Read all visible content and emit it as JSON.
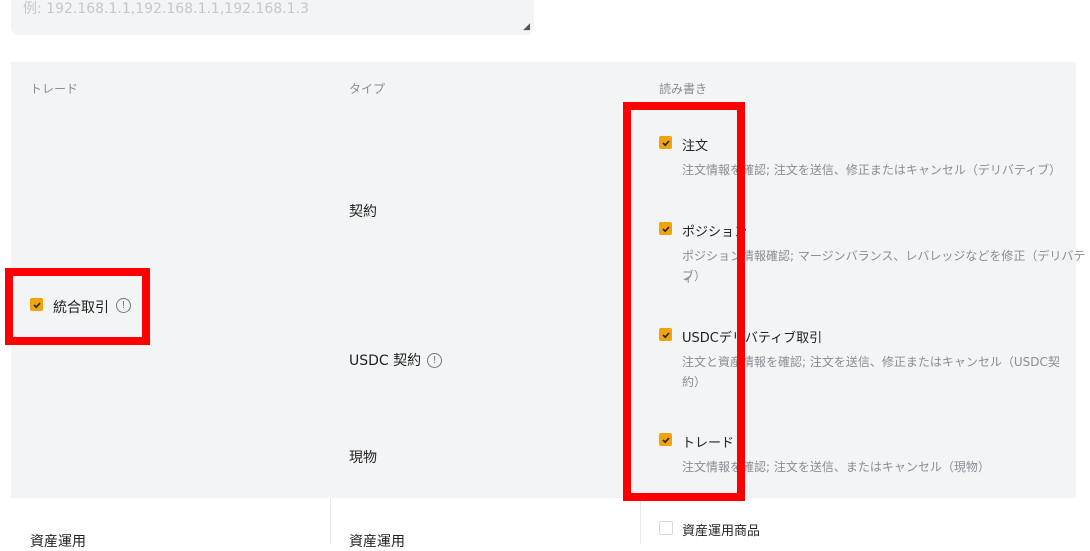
{
  "ip_textarea": {
    "placeholder": "例: 192.168.1.1,192.168.1.1,192.168.1.3"
  },
  "table": {
    "headers": {
      "trade": "トレード",
      "type": "タイプ",
      "rw": "読み書き"
    },
    "group": {
      "label": "統合取引",
      "checked": true
    },
    "types": {
      "contract": "契約",
      "usdc": "USDC 契約",
      "spot": "現物"
    },
    "permissions": [
      {
        "label": "注文",
        "desc": "注文情報を確認; 注文を送信、修正またはキャンセル（デリバティブ）",
        "checked": true
      },
      {
        "label": "ポジション",
        "desc_line1": "ポジション情報確認; マージンバランス、レバレッジなどを修正（デリバティ",
        "desc_line2": "ブ）",
        "checked": true
      },
      {
        "label": "USDCデリバティブ取引",
        "desc_line1": "注文と資産情報を確認; 注文を送信、修正またはキャンセル（USDC契",
        "desc_line2": "約）",
        "checked": true
      },
      {
        "label": "トレード",
        "desc": "注文情報を確認; 注文を送信、またはキャンセル（現物）",
        "checked": true
      }
    ],
    "row2": {
      "trade": "資産運用",
      "type": "資産運用",
      "perm": "資産運用商品",
      "checked": false
    }
  },
  "colors": {
    "accent": "#f0a30a",
    "panel_bg": "#f3f4f5",
    "highlight": "#ff0000"
  }
}
